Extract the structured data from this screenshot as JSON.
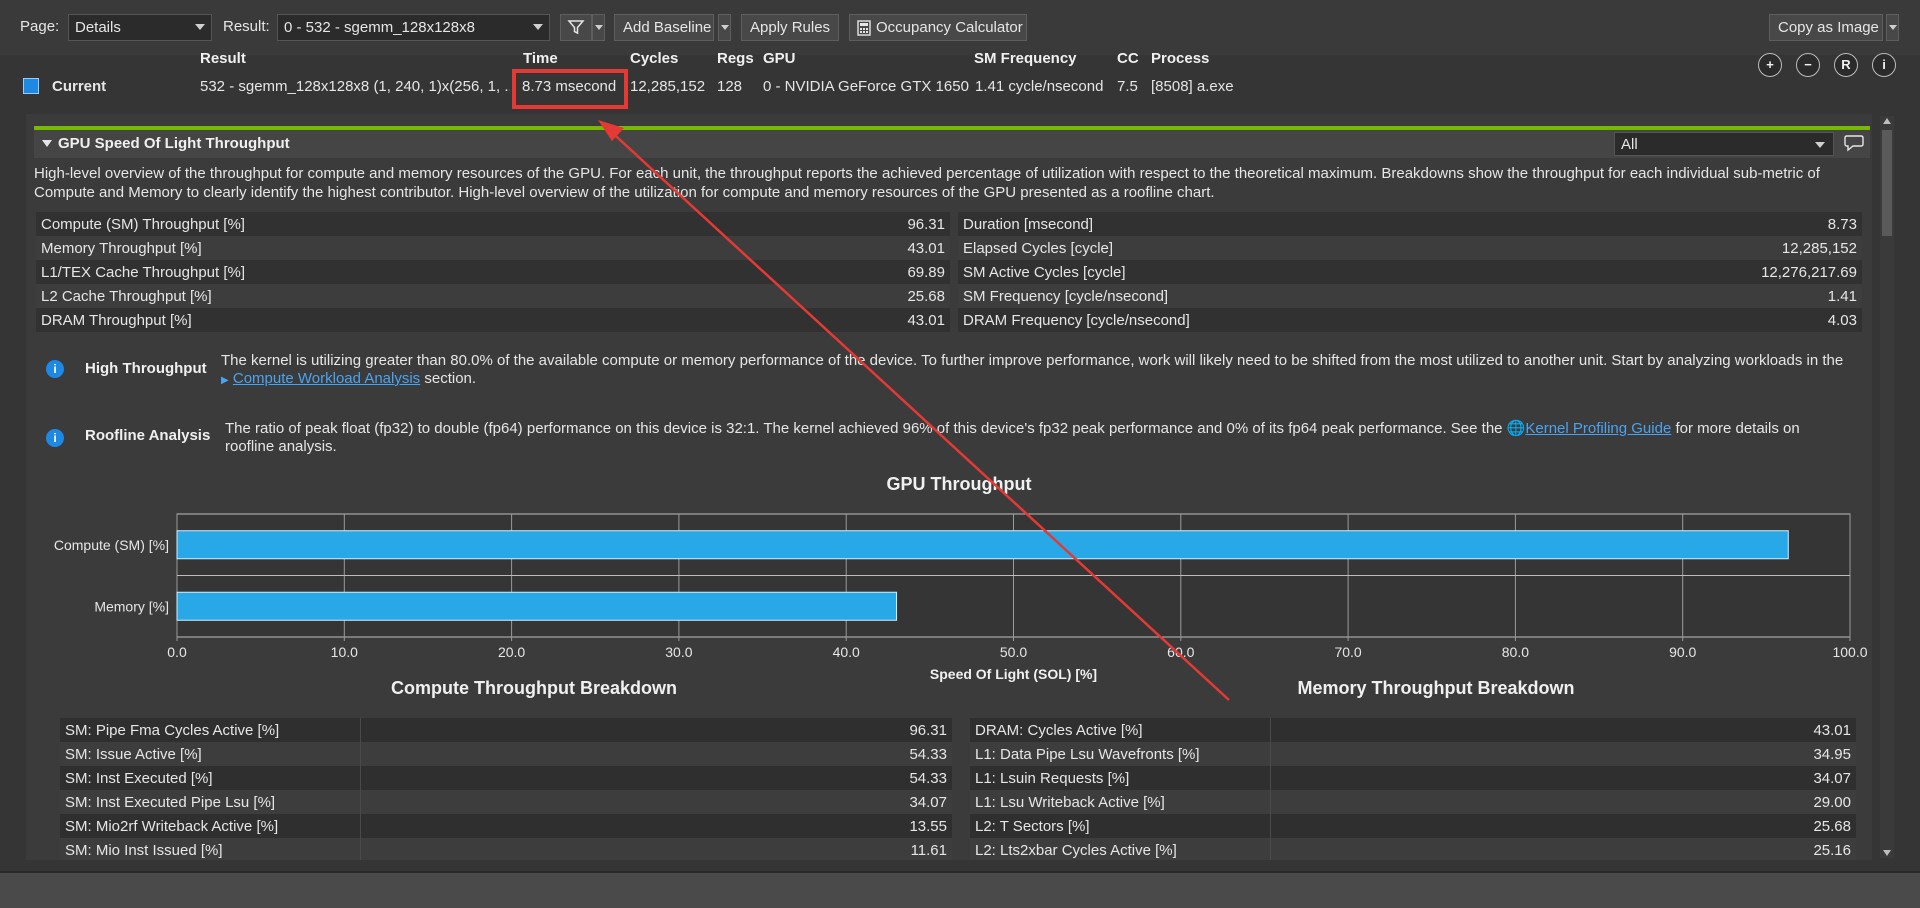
{
  "toolbar": {
    "page_label": "Page:",
    "page_value": "Details",
    "result_label": "Result:",
    "result_value": "0 -   532 - sgemm_128x128x8",
    "add_baseline": "Add Baseline",
    "apply_rules": "Apply Rules",
    "occupancy": "Occupancy Calculator",
    "copy_image": "Copy as Image"
  },
  "header": {
    "cols": {
      "result": "Result",
      "time": "Time",
      "cycles": "Cycles",
      "regs": "Regs",
      "gpu": "GPU",
      "smfreq": "SM Frequency",
      "cc": "CC",
      "process": "Process"
    },
    "current": {
      "label": "Current",
      "result": "532 - sgemm_128x128x8 (1, 240, 1)x(256, 1, ...",
      "time": "8.73 msecond",
      "cycles": "12,285,152",
      "regs": "128",
      "gpu": "0 - NVIDIA GeForce GTX 1650",
      "smfreq": "1.41 cycle/nsecond",
      "cc": "7.5",
      "process": "[8508] a.exe"
    },
    "buttons": [
      "+",
      "−",
      "R",
      "i"
    ]
  },
  "section": {
    "title": "GPU Speed Of Light Throughput",
    "filter": "All",
    "description": "High-level overview of the throughput for compute and memory resources of the GPU. For each unit, the throughput reports the achieved percentage of utilization with respect to the theoretical maximum. Breakdowns show the throughput for each individual sub-metric of Compute and Memory to clearly identify the highest contributor. High-level overview of the utilization for compute and memory resources of the GPU presented as a roofline chart."
  },
  "metrics_left": [
    {
      "name": "Compute (SM) Throughput [%]",
      "value": "96.31"
    },
    {
      "name": "Memory Throughput [%]",
      "value": "43.01"
    },
    {
      "name": "L1/TEX Cache Throughput [%]",
      "value": "69.89"
    },
    {
      "name": "L2 Cache Throughput [%]",
      "value": "25.68"
    },
    {
      "name": "DRAM Throughput [%]",
      "value": "43.01"
    }
  ],
  "metrics_right": [
    {
      "name": "Duration [msecond]",
      "value": "8.73"
    },
    {
      "name": "Elapsed Cycles [cycle]",
      "value": "12,285,152"
    },
    {
      "name": "SM Active Cycles [cycle]",
      "value": "12,276,217.69"
    },
    {
      "name": "SM Frequency [cycle/nsecond]",
      "value": "1.41"
    },
    {
      "name": "DRAM Frequency [cycle/nsecond]",
      "value": "4.03"
    }
  ],
  "rules": {
    "high_throughput": {
      "name": "High Throughput",
      "text": "The kernel is utilizing greater than 80.0% of the available compute or memory performance of the device. To further improve performance, work will likely need to be shifted from the most utilized to another unit. Start by analyzing workloads in the",
      "link": "Compute Workload Analysis",
      "after": " section."
    },
    "roofline": {
      "name": "Roofline Analysis",
      "text": "The ratio of peak float (fp32) to double (fp64) performance on this device is 32:1. The kernel achieved 96% of this device's fp32 peak performance and 0% of its fp64 peak performance. See the ",
      "link": "Kernel Profiling Guide",
      "after": " for more details on roofline analysis."
    }
  },
  "chart_data": {
    "type": "bar",
    "orientation": "horizontal",
    "title": "GPU Throughput",
    "categories": [
      "Compute (SM) [%]",
      "Memory [%]"
    ],
    "values": [
      96.31,
      43.01
    ],
    "xlabel": "Speed Of Light (SOL) [%]",
    "xlim": [
      0,
      100
    ],
    "ticks": [
      "0.0",
      "10.0",
      "20.0",
      "30.0",
      "40.0",
      "50.0",
      "60.0",
      "70.0",
      "80.0",
      "90.0",
      "100.0"
    ],
    "grid": true,
    "bar_color": "#29a8e8"
  },
  "compute_breakdown": {
    "title": "Compute Throughput Breakdown",
    "rows": [
      {
        "name": "SM: Pipe Fma Cycles Active [%]",
        "value": "96.31"
      },
      {
        "name": "SM: Issue Active [%]",
        "value": "54.33"
      },
      {
        "name": "SM: Inst Executed [%]",
        "value": "54.33"
      },
      {
        "name": "SM: Inst Executed Pipe Lsu [%]",
        "value": "34.07"
      },
      {
        "name": "SM: Mio2rf Writeback Active [%]",
        "value": "13.55"
      },
      {
        "name": "SM: Mio Inst Issued [%]",
        "value": "11.61"
      }
    ]
  },
  "memory_breakdown": {
    "title": "Memory Throughput Breakdown",
    "rows": [
      {
        "name": "DRAM: Cycles Active [%]",
        "value": "43.01"
      },
      {
        "name": "L1: Data Pipe Lsu Wavefronts [%]",
        "value": "34.95"
      },
      {
        "name": "L1: Lsuin Requests [%]",
        "value": "34.07"
      },
      {
        "name": "L1: Lsu Writeback Active [%]",
        "value": "29.00"
      },
      {
        "name": "L2: T Sectors [%]",
        "value": "25.68"
      },
      {
        "name": "L2: Lts2xbar Cycles Active [%]",
        "value": "25.16"
      }
    ]
  },
  "colors": {
    "accent_green": "#76b900",
    "annotation_red": "#e53935",
    "info_blue": "#1e88e5"
  }
}
